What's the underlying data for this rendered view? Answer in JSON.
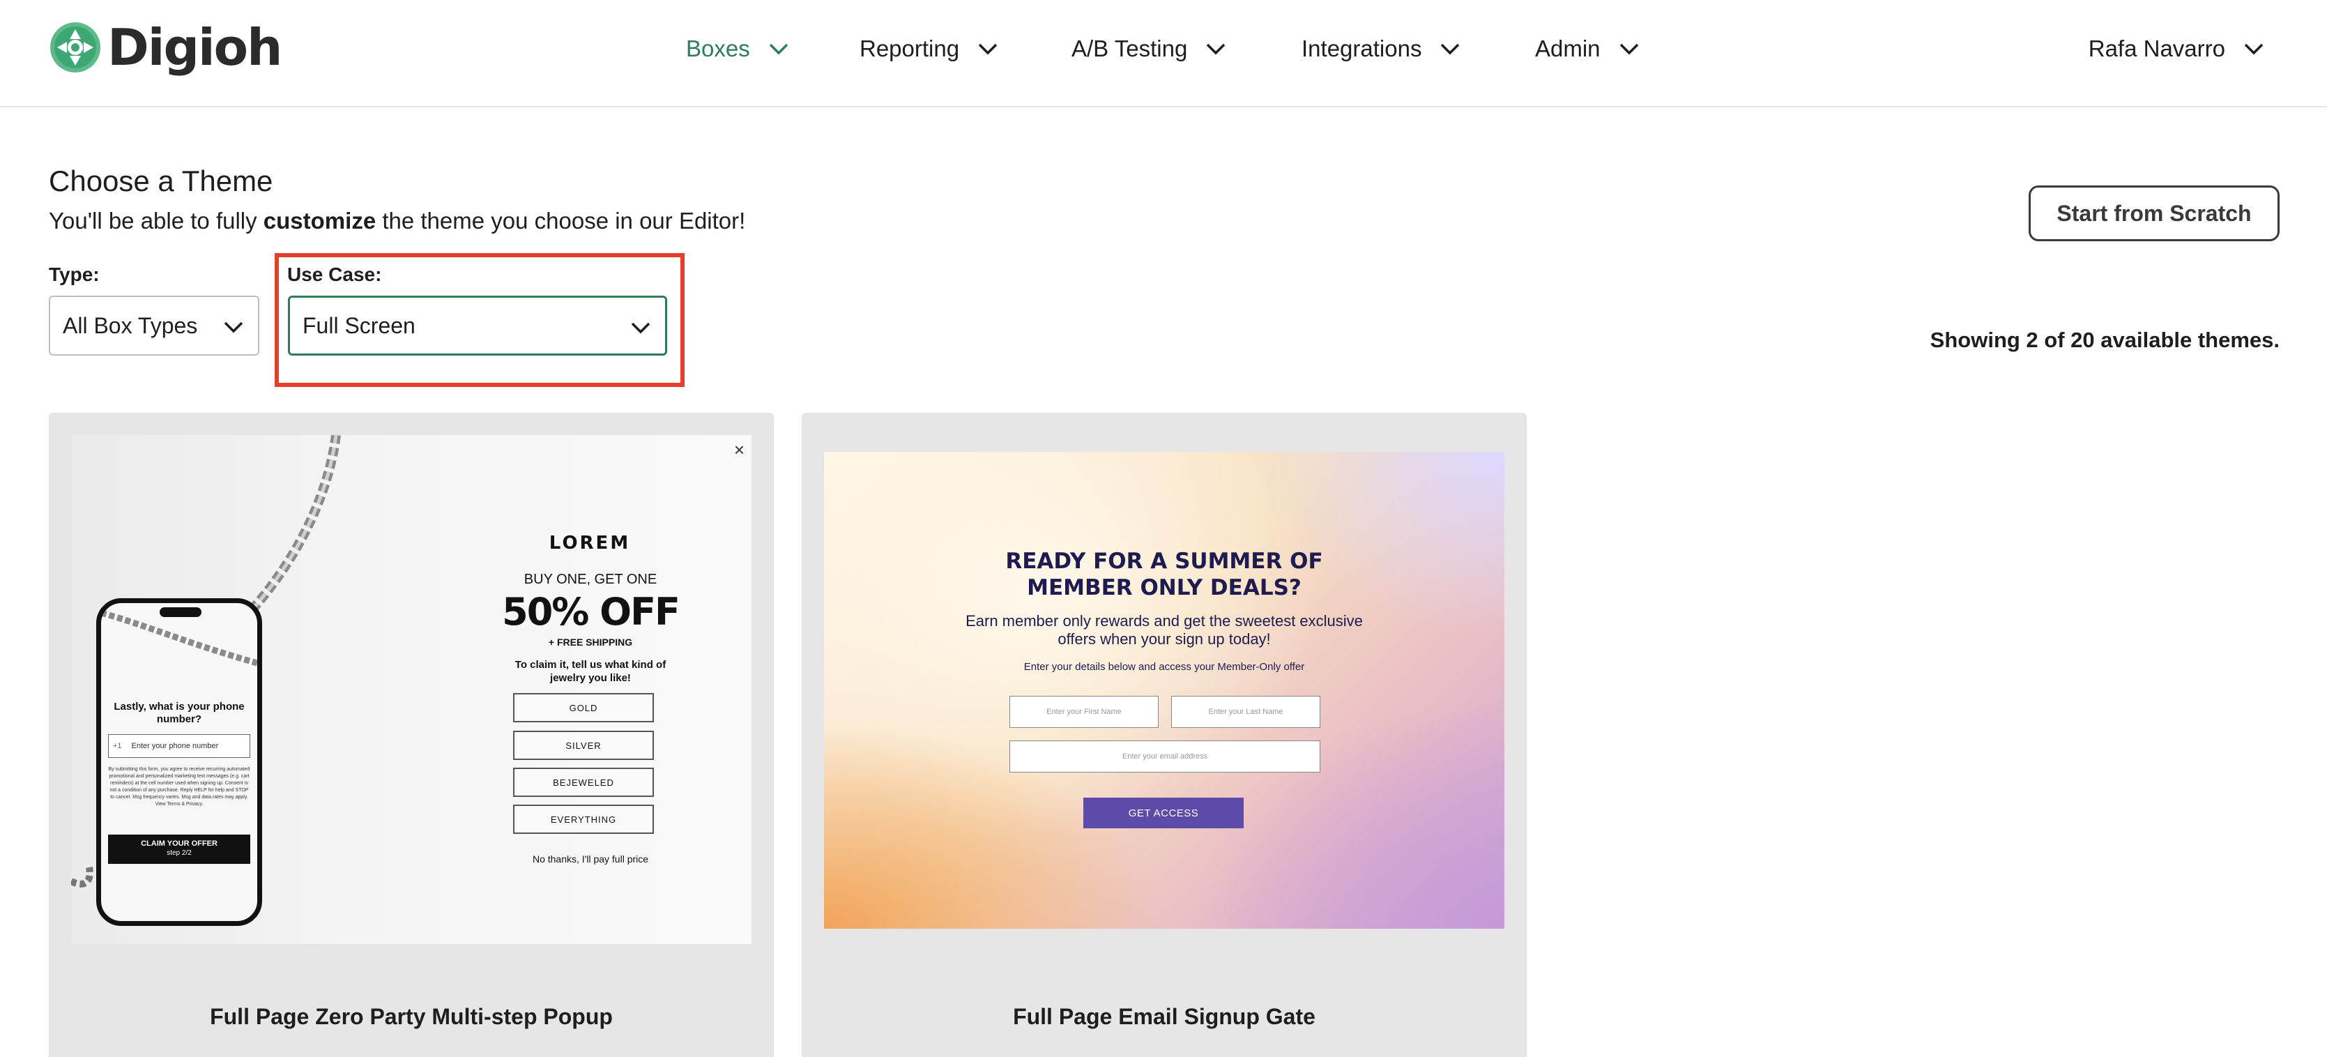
{
  "header": {
    "logo_text": "Digioh",
    "nav": [
      {
        "label": "Boxes",
        "active": true
      },
      {
        "label": "Reporting"
      },
      {
        "label": "A/B Testing"
      },
      {
        "label": "Integrations"
      },
      {
        "label": "Admin"
      }
    ],
    "user": "Rafa Navarro"
  },
  "page": {
    "title": "Choose a Theme",
    "subtitle_pre": "You'll be able to fully ",
    "subtitle_bold": "customize",
    "subtitle_post": " the theme you choose in our Editor!",
    "start_scratch": "Start from Scratch",
    "showing": "Showing 2 of 20 available themes."
  },
  "filters": {
    "type_label": "Type:",
    "type_value": "All Box Types",
    "usecase_label": "Use Case:",
    "usecase_value": "Full Screen"
  },
  "themes": [
    {
      "title": "Full Page Zero Party Multi-step Popup",
      "preview": {
        "close": "×",
        "brand": "LOREM",
        "bogo": "BUY ONE, GET ONE",
        "offer": "50% OFF",
        "free_shipping": "+ FREE SHIPPING",
        "claim_text": "To claim it, tell us what kind of jewelry you like!",
        "options": [
          "GOLD",
          "SILVER",
          "BEJEWELED",
          "EVERYTHING"
        ],
        "no_thanks": "No thanks, I'll pay full price",
        "phone": {
          "question": "Lastly, what is your phone number?",
          "country_code": "+1",
          "placeholder": "Enter your phone number",
          "legal": "By submitting this form, you agree to receive recurring automated promotional and personalized marketing text messages (e.g. cart reminders) at the cell number used when signing up. Consent is not a condition of any purchase. Reply HELP for help and STOP to cancel. Msg frequency varies. Msg and data rates may apply. View Terms & Privacy.",
          "cta": "CLAIM YOUR OFFER",
          "cta_step": "step 2/2"
        }
      }
    },
    {
      "title": "Full Page Email Signup Gate",
      "preview": {
        "headline": "READY FOR A SUMMER OF MEMBER ONLY DEALS?",
        "sub": "Earn member only rewards and get the sweetest exclusive offers when your sign up today!",
        "hint": "Enter your details below and access your Member-Only offer",
        "first_name": "Enter your First Name",
        "last_name": "Enter your Last Name",
        "email": "Enter your email address",
        "button": "GET ACCESS"
      }
    }
  ],
  "colors": {
    "brand_green": "#2f7d57",
    "highlight_red": "#e3402f",
    "gate_button": "#5c4ba8",
    "gate_text": "#1d1b4f"
  }
}
